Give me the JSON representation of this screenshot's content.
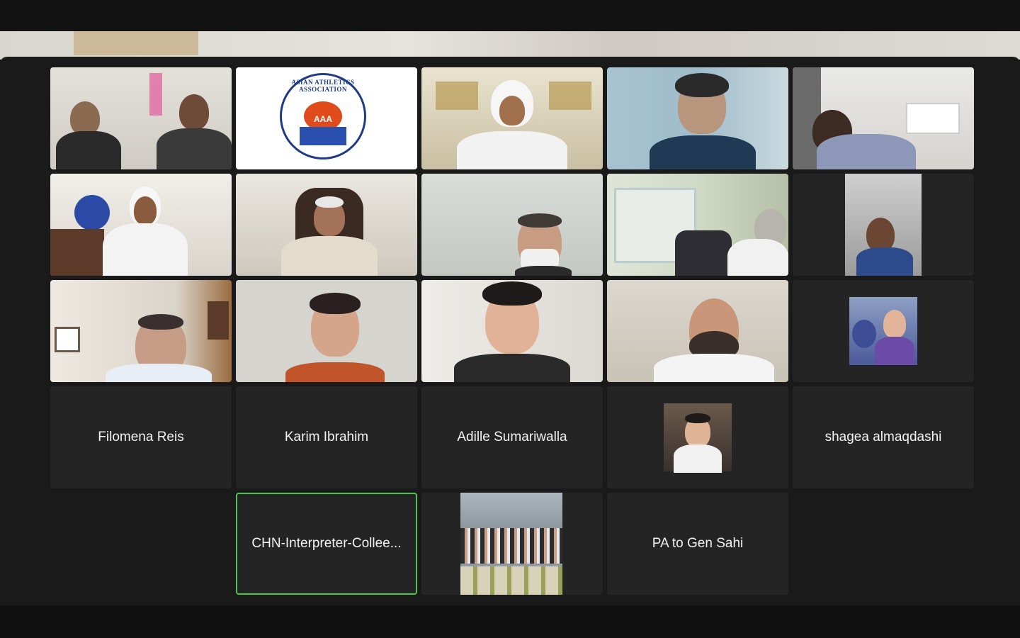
{
  "participants": [
    {
      "id": "p01",
      "kind": "video",
      "icon": "two-men-at-desk"
    },
    {
      "id": "p02",
      "kind": "logo",
      "logo_text": "ASIAN ATHLETICS ASSOCIATION",
      "logo_mark": "AAA"
    },
    {
      "id": "p03",
      "kind": "video",
      "icon": "man-in-ghutra-trophy-shelf"
    },
    {
      "id": "p04",
      "kind": "video",
      "icon": "man-resting-head"
    },
    {
      "id": "p05",
      "kind": "video",
      "icon": "man-with-bookshelf"
    },
    {
      "id": "p06",
      "kind": "video",
      "icon": "man-in-ghutra-office"
    },
    {
      "id": "p07",
      "kind": "video",
      "icon": "man-in-chair"
    },
    {
      "id": "p08",
      "kind": "video",
      "icon": "man-with-mask"
    },
    {
      "id": "p09",
      "kind": "video",
      "icon": "gaming-chair-room"
    },
    {
      "id": "p10",
      "kind": "video",
      "icon": "man-in-car"
    },
    {
      "id": "p11",
      "kind": "video",
      "icon": "man-reading"
    },
    {
      "id": "p12",
      "kind": "video",
      "icon": "woman-with-glasses"
    },
    {
      "id": "p13",
      "kind": "video",
      "icon": "woman-speaking"
    },
    {
      "id": "p14",
      "kind": "video",
      "icon": "man-with-beard"
    },
    {
      "id": "p15",
      "kind": "photo",
      "icon": "woman-with-flowers"
    },
    {
      "id": "p16",
      "kind": "name",
      "name": "Filomena Reis"
    },
    {
      "id": "p17",
      "kind": "name",
      "name": "Karim Ibrahim"
    },
    {
      "id": "p18",
      "kind": "name",
      "name": "Adille Sumariwalla"
    },
    {
      "id": "p19",
      "kind": "photo",
      "icon": "man-portrait-outdoors"
    },
    {
      "id": "p20",
      "kind": "name",
      "name": "shagea almaqdashi"
    },
    {
      "id": "p21",
      "kind": "name",
      "name": "CHN-Interpreter-Collee...",
      "active": true
    },
    {
      "id": "p22",
      "kind": "photo",
      "icon": "group-photo"
    },
    {
      "id": "p23",
      "kind": "name",
      "name": "PA to Gen Sahi"
    }
  ],
  "colors": {
    "active_border": "#50c34a",
    "tile_bg": "#242424"
  }
}
